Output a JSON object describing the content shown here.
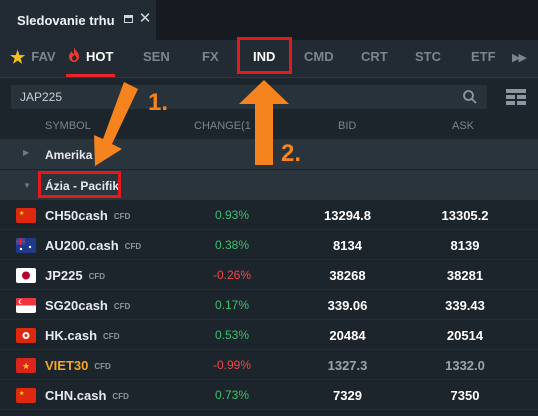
{
  "window": {
    "title": "Sledovanie trhu"
  },
  "tabs": [
    {
      "label": "FAV",
      "icon": "star-icon"
    },
    {
      "label": "HOT",
      "icon": "fire-icon",
      "active": true
    },
    {
      "label": "SEN"
    },
    {
      "label": "FX"
    },
    {
      "label": "IND"
    },
    {
      "label": "CMD"
    },
    {
      "label": "CRT"
    },
    {
      "label": "STC"
    },
    {
      "label": "ETF"
    }
  ],
  "search": {
    "value": "JAP225"
  },
  "columns": {
    "symbol": "SYMBOL",
    "change": "CHANGE(1",
    "bid": "BID",
    "ask": "ASK"
  },
  "groups": [
    {
      "label": "Amerika",
      "expanded": false
    },
    {
      "label": "Ázia - Pacifik",
      "expanded": true
    }
  ],
  "instruments": [
    {
      "symbol": "CH50cash",
      "tag": "CFD",
      "change": "0.93%",
      "bid": "13294.8",
      "ask": "13305.2",
      "trend": "pos"
    },
    {
      "symbol": "AU200.cash",
      "tag": "CFD",
      "change": "0.38%",
      "bid": "8134",
      "ask": "8139",
      "trend": "pos"
    },
    {
      "symbol": "JP225",
      "tag": "CFD",
      "change": "-0.26%",
      "bid": "38268",
      "ask": "38281",
      "trend": "neg"
    },
    {
      "symbol": "SG20cash",
      "tag": "CFD",
      "change": "0.17%",
      "bid": "339.06",
      "ask": "339.43",
      "trend": "pos"
    },
    {
      "symbol": "HK.cash",
      "tag": "CFD",
      "change": "0.53%",
      "bid": "20484",
      "ask": "20514",
      "trend": "pos"
    },
    {
      "symbol": "VIET30",
      "tag": "CFD",
      "change": "-0.99%",
      "bid": "1327.3",
      "ask": "1332.0",
      "trend": "neg",
      "market_closed": true
    },
    {
      "symbol": "CHN.cash",
      "tag": "CFD",
      "change": "0.73%",
      "bid": "7329",
      "ask": "7350",
      "trend": "pos"
    }
  ],
  "annotations": {
    "step1": "1.",
    "step2": "2."
  },
  "colors": {
    "accent_red": "#e9242b",
    "annotation_orange": "#f5841f",
    "positive": "#3ebf6f",
    "negative": "#f2474a"
  }
}
